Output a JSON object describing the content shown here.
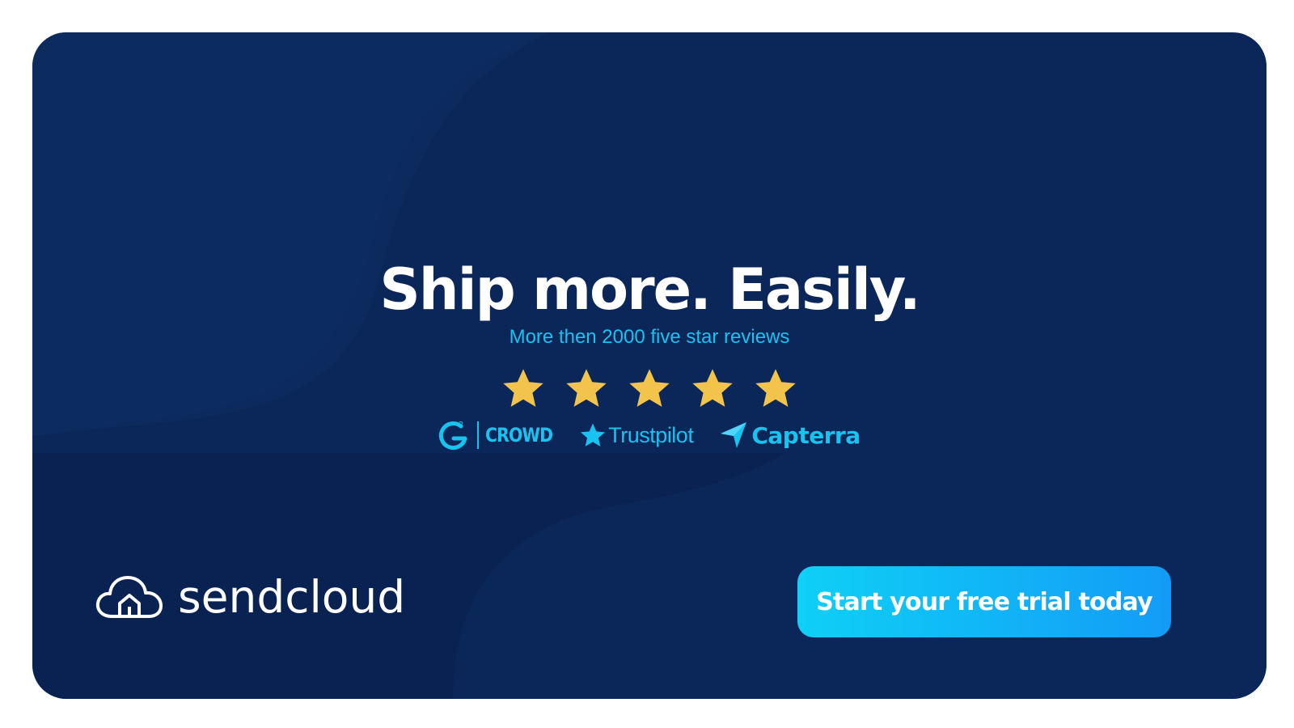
{
  "banner": {
    "headline": "Ship more. Easily.",
    "subline": "More then 2000 five star reviews",
    "rating": {
      "value": 5,
      "max": 5
    },
    "review_sites": [
      {
        "name": "G2 Crowd",
        "logo_text": "CROWD",
        "icon": "g2-logo-icon"
      },
      {
        "name": "Trustpilot",
        "logo_text": "Trustpilot",
        "icon": "trustpilot-star-icon"
      },
      {
        "name": "Capterra",
        "logo_text": "Capterra",
        "icon": "capterra-arrow-icon"
      }
    ],
    "brand": {
      "name": "sendcloud",
      "icon": "cloud-logo-icon"
    },
    "cta_label": "Start your free trial today"
  },
  "colors": {
    "background": "#0b2658",
    "accent": "#19c3f0",
    "star": "#f2c44c",
    "cta_start": "#0fd0f6",
    "cta_end": "#139cf7"
  }
}
